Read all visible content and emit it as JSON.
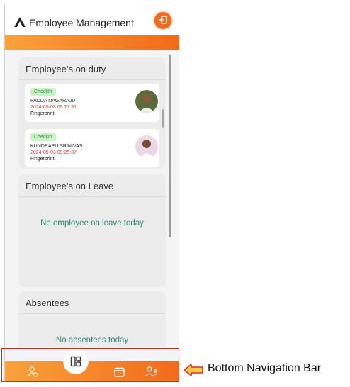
{
  "header": {
    "title": "Employee Management",
    "logout_label": "logout"
  },
  "on_duty": {
    "title": "Employee’s on duty",
    "employees": [
      {
        "status": "CheckIn",
        "name": "PADDA NAGARAJU",
        "time": "2024-05-03 09:27:31",
        "method": "Fingerprint"
      },
      {
        "status": "CheckIn",
        "name": "KUNDRAPU SRINIVAS",
        "time": "2024-05-03 09:25:37",
        "method": "Fingerprint"
      }
    ]
  },
  "on_leave": {
    "title": "Employee’s on Leave",
    "empty_message": "No employee on leave today"
  },
  "absentees": {
    "title": "Absentees",
    "empty_message": "No absentees today"
  },
  "bottom_nav": {
    "items": [
      {
        "icon": "user-clock-icon"
      },
      {
        "icon": "dashboard-icon",
        "active": true
      },
      {
        "icon": "calendar-icon"
      },
      {
        "icon": "users-settings-icon"
      }
    ]
  },
  "annotation": {
    "label": "Bottom Navigation Bar"
  },
  "colors": {
    "accent": "#f26a1b",
    "accent_light": "#f9a23b",
    "highlight": "#c9322b",
    "badge_bg": "#c9f3c4",
    "time_red": "#e0413a",
    "empty_text": "#2a8a7a"
  }
}
